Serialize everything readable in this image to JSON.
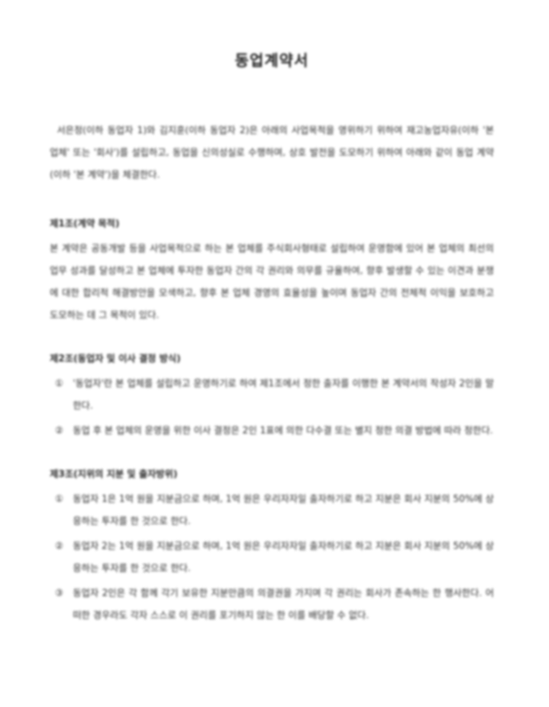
{
  "document": {
    "title": "동업계약서",
    "intro": "서은정(이하 동업자 1)와 김지훈(이하 동업자 2)은 아래의 사업목적을 영위하기 위하여 재고농업자유(이하 '본 업체' 또는 '회사')를 설립하고, 동업을 신의성실로 수행하며, 상호 발전을 도모하기 위하여 아래와 같이 동업 계약(이하 '본 계약')을 체결한다.",
    "articles": [
      {
        "title": "제1조(계약 목적)",
        "body": "본 계약은 공동개발 등을 사업목적으로 하는 본 업체를 주식회사형태로 설립하여 운영함에 있어 본 업체의 최선의 업무 성과를 달성하고 본 업체에 투자한 동업자 간의 각 권리와 의무를 규율하여, 향후 발생할 수 있는 이견과 분쟁에 대한 합리적 해결방안을 모색하고, 향후 본 업체 경영의 효율성을 높이며 동업자 간의 전체적 이익을 보호하고 도모하는 데 그 목적이 있다."
      },
      {
        "title": "제2조(동업자 및 이사 결정 방식)",
        "items": [
          {
            "num": "①",
            "text": "'동업자'란 본 업체를 설립하고 운영하기로 하여 제1조에서 정한 출자를 이행한 본 계약서의 작성자 2인을 말한다."
          },
          {
            "num": "②",
            "text": "동업 후 본 업체의 운영을 위한 이사 결정은 2인 1표에 의한 다수결 또는 별지 정한 의결 방법에 따라 정한다."
          }
        ]
      },
      {
        "title": "제3조(지위의 지분 및 출자방위)",
        "items": [
          {
            "num": "①",
            "text": "동업자 1은 1억 원을 지분금으로 하며, 1억 원은 우리자자일 출자하기로 하고 지분은 회사 지분의 50%에 상응하는 투자를 한 것으로 한다."
          },
          {
            "num": "②",
            "text": "동업자 2는 1억 원을 지분금으로 하며, 1억 원은 우리자자일 출자하기로 하고 지분은 회사 지분의 50%에 상응하는 투자를 한 것으로 한다."
          },
          {
            "num": "③",
            "text": "동업자 2인은 각 함께 각기 보유한 지분만큼의 의결권을 가지며 각 권리는 회사가 존속하는 한 행사한다. 어떠한 경우라도 각자 스스로 이 권리를 포기하지 않는 한 이를 배당할 수 없다."
          }
        ]
      }
    ]
  }
}
